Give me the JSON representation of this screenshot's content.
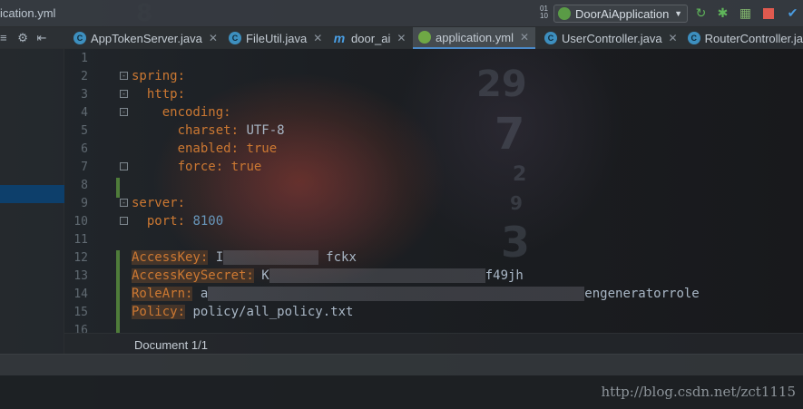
{
  "toolbar": {
    "breadcrumb_file": "ication.yml",
    "run_config": "DoorAiApplication"
  },
  "tabs": [
    {
      "label": "AppTokenServer.java",
      "icon": "class-icon",
      "active": false
    },
    {
      "label": "FileUtil.java",
      "icon": "class-icon",
      "active": false
    },
    {
      "label": "door_ai",
      "icon": "maven-icon",
      "active": false
    },
    {
      "label": "application.yml",
      "icon": "yaml-icon",
      "active": true
    },
    {
      "label": "UserController.java",
      "icon": "class-icon",
      "active": false
    },
    {
      "label": "RouterController.ja",
      "icon": "class-icon",
      "active": false
    }
  ],
  "editor": {
    "line_numbers": [
      "1",
      "2",
      "3",
      "4",
      "5",
      "6",
      "7",
      "8",
      "9",
      "10",
      "11",
      "12",
      "13",
      "14",
      "15",
      "16"
    ],
    "lines": {
      "l2_key": "spring:",
      "l3_key": "  http:",
      "l4_key": "    encoding:",
      "l5_key": "      charset:",
      "l5_val": " UTF-8",
      "l6_key": "      enabled:",
      "l6_val": " true",
      "l7_key": "      force:",
      "l7_val": " true",
      "l9_key": "server:",
      "l10_key": "  port:",
      "l10_val": " 8100",
      "l12_key": "AccessKey:",
      "l12_val_a": " I",
      "l12_val_b": "fckx",
      "l13_key": "AccessKeySecret:",
      "l13_val_a": " K",
      "l13_val_b": "f49jh",
      "l14_key": "RoleArn:",
      "l14_val_a": " a",
      "l14_val_b": "engeneratorrole",
      "l15_key": "Policy:",
      "l15_val": " policy/all_policy.txt"
    },
    "document_status": "Document 1/1"
  },
  "watermark": "http://blog.csdn.net/zct1115",
  "colors": {
    "keyword": "#cc7832",
    "number": "#6897bb",
    "text": "#a9b7c6"
  }
}
